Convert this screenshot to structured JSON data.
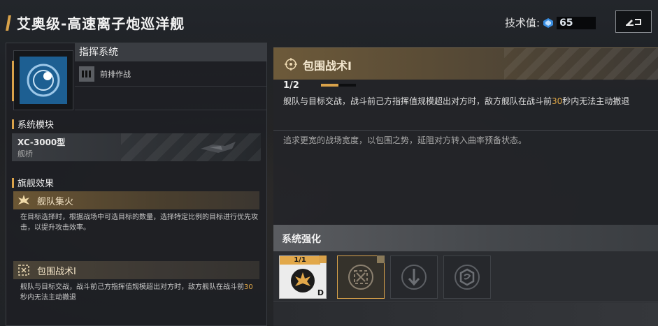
{
  "header": {
    "title": "艾奥级-高速离子炮巡洋舰",
    "tech_label": "技术值:",
    "tech_value": "65"
  },
  "command": {
    "header": "指挥系统",
    "tag": "前排作战"
  },
  "system_module": {
    "section_title": "系统模块",
    "name": "XC-3000型",
    "sub": "舰桥"
  },
  "flagship": {
    "section_title": "旗舰效果",
    "effects": [
      {
        "title": "舰队集火",
        "desc": "在目标选择时，根据战场中可选目标的数量，选择特定比例的目标进行优先攻击，以提升攻击效率。"
      },
      {
        "title": "包围战术Ⅰ",
        "desc_before": "舰队与目标交战，战斗前己方指挥值规模超出对方时，敌方舰队在战斗前",
        "desc_highlight": "30",
        "desc_after": "秒内无法主动撤退"
      }
    ]
  },
  "detail": {
    "title": "包围战术Ⅰ",
    "level": "1/2",
    "level_progress": 0.5,
    "desc_before": "舰队与目标交战，战斗前己方指挥值规模超出对方时，敌方舰队在战斗前",
    "desc_highlight": "30",
    "desc_after": "秒内无法主动撤退",
    "flavor": "追求更宽的战场宽度，以包围之势，延阻对方转入曲率预备状态。"
  },
  "enhancement": {
    "title": "系统强化",
    "slots": [
      {
        "count": "1/1",
        "grade": "D",
        "icon": "crown-burst-icon",
        "state": "owned"
      },
      {
        "icon": "encircle-icon",
        "state": "selected"
      },
      {
        "icon": "down-arrow-icon",
        "state": "locked"
      },
      {
        "icon": "hex-swirl-icon",
        "state": "locked"
      }
    ]
  },
  "colors": {
    "accent": "#d9a24a",
    "highlight": "#e0a848",
    "module_blue": "#1d5f92"
  }
}
